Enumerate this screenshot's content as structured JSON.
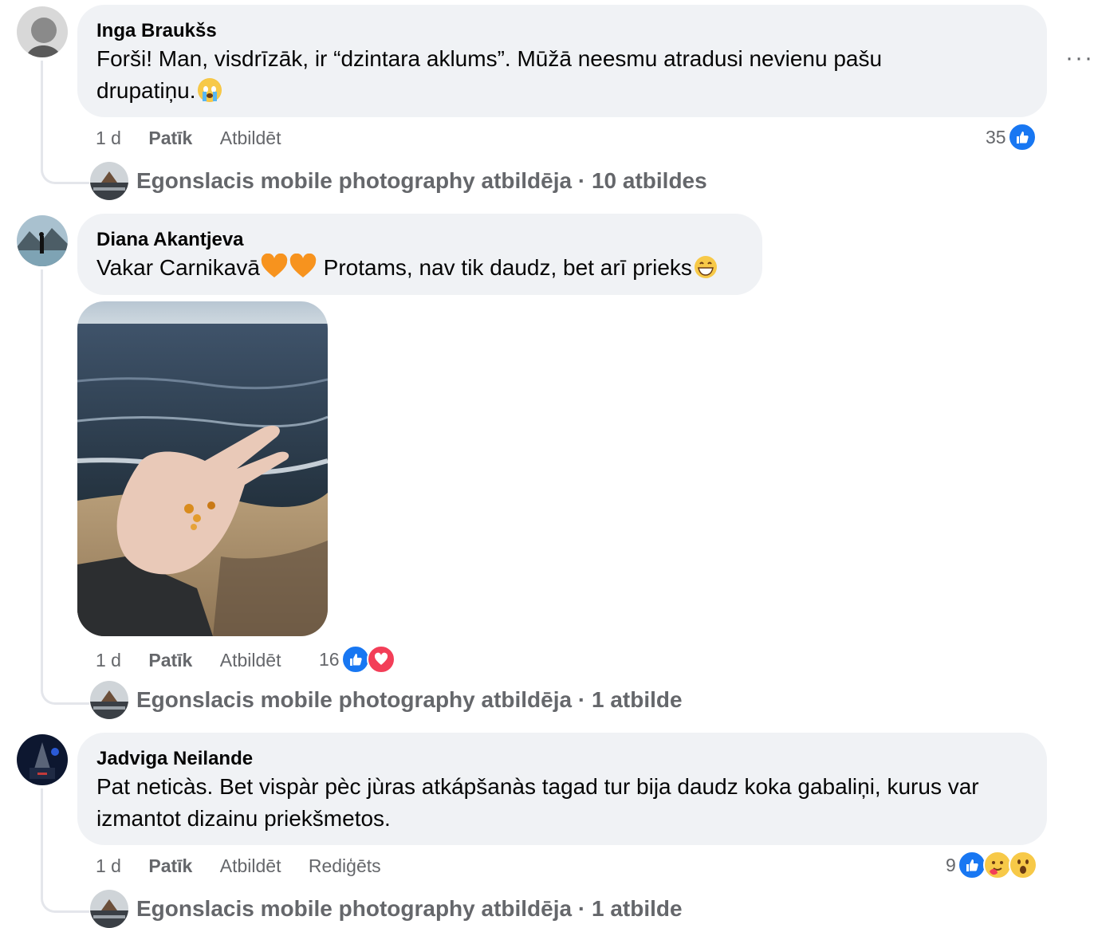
{
  "comments": [
    {
      "author": "Inga Braukšs",
      "line1": "Forši! Man, visdrīzāk, ir “dzintara aklums”. Mūžā neesmu atradusi nevienu pašu",
      "line2": "drupatiņu.",
      "time": "1 d",
      "like_label": "Patīk",
      "reply_label": "Atbildēt",
      "reaction_count": "35",
      "reply_summary": "Egonslacis mobile photography atbildēja · 10 atbildes"
    },
    {
      "author": "Diana Akantjeva",
      "text_a": "Vakar Carnikavā",
      "text_b": " Protams, nav tik daudz, bet arī prieks",
      "time": "1 d",
      "like_label": "Patīk",
      "reply_label": "Atbildēt",
      "reaction_count": "16",
      "reply_summary": "Egonslacis mobile photography atbildēja · 1 atbilde"
    },
    {
      "author": "Jadviga Neilande",
      "line1": "Pat neticàs. Bet vispàr pèc jùras atkápšanàs tagad tur bija daudz koka gabaliņi, kurus var",
      "line2": "izmantot dizainu priekšmetos.",
      "time": "1 d",
      "like_label": "Patīk",
      "reply_label": "Atbildēt",
      "edit_label": "Rediģēts",
      "reaction_count": "9",
      "reply_summary": "Egonslacis mobile photography atbildēja · 1 atbilde"
    }
  ],
  "more_label": "···",
  "icons": {
    "like": "thumbs-up-icon",
    "love": "heart-icon",
    "care": "care-icon",
    "wow": "wow-icon",
    "crying": "crying-face-emoji",
    "orange_heart": "orange-heart-emoji",
    "grin": "grinning-face-emoji"
  },
  "colors": {
    "like_blue": "#1877f2",
    "love_red": "#f33e58",
    "bubble_bg": "#f0f2f5",
    "meta_gray": "#65676b"
  }
}
